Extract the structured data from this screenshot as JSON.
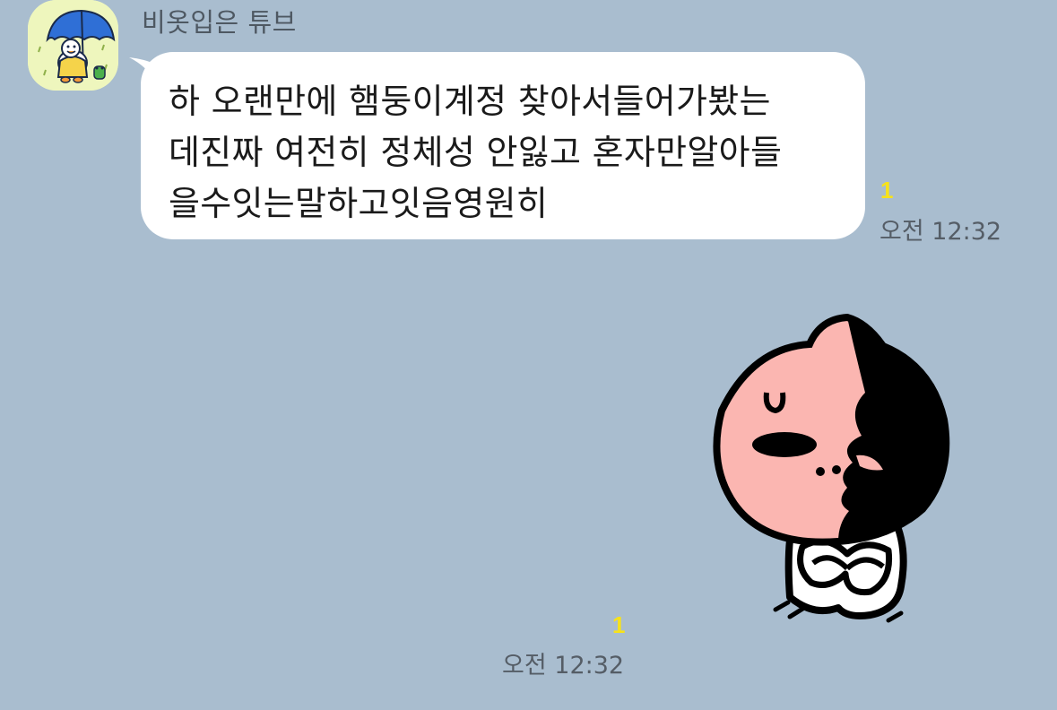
{
  "chat": {
    "sender_name": "비옷입은 튜브",
    "avatar_icon": "tube-umbrella-avatar-icon",
    "messages": [
      {
        "type": "text",
        "lines": [
          "하 오랜만에 햄둥이계정 찾아서들어가봤는",
          "데진짜 여전히 정체성 안잃고 혼자만알아들",
          "을수잇는말하고잇음영원히"
        ],
        "unread_count": "1",
        "time": "오전 12:32"
      },
      {
        "type": "sticker",
        "sticker_icon": "apeach-sitting-sticker-icon",
        "unread_count": "1",
        "time": "오전 12:32"
      }
    ]
  },
  "colors": {
    "background": "#a9bdcf",
    "bubble": "#ffffff",
    "unread": "#f7e21a",
    "time_text": "#555d66"
  }
}
